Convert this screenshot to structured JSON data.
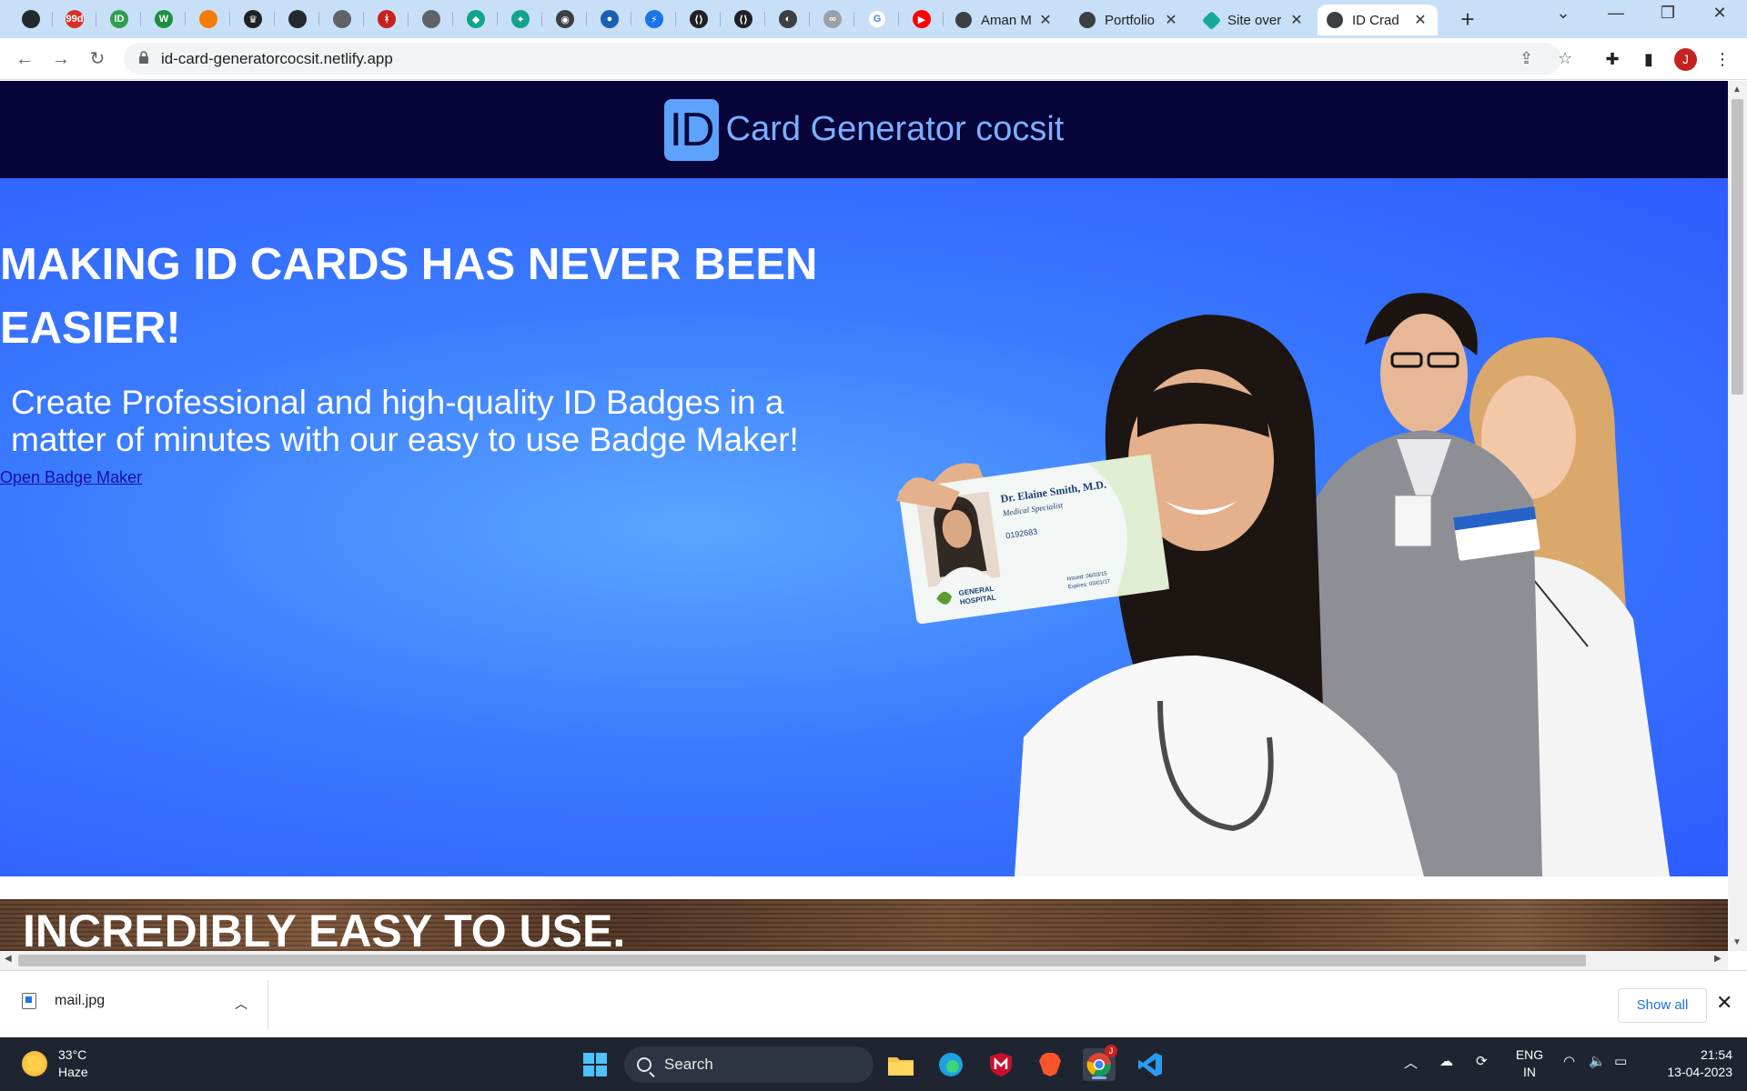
{
  "browser": {
    "pinned_tabs": [
      {
        "icon": "github-icon",
        "color": "#24292e",
        "glyph": ""
      },
      {
        "icon": "99d-icon",
        "color": "#d93025",
        "glyph": "99d"
      },
      {
        "icon": "id-icon",
        "color": "#2e9e4f",
        "glyph": "ID"
      },
      {
        "icon": "w-icon",
        "color": "#1e8e3e",
        "glyph": "W"
      },
      {
        "icon": "orange-chat-icon",
        "color": "#f57c00",
        "glyph": ""
      },
      {
        "icon": "crown-icon",
        "color": "#202124",
        "glyph": "♛"
      },
      {
        "icon": "github-icon",
        "color": "#24292e",
        "glyph": ""
      },
      {
        "icon": "github-icon",
        "color": "#5f6368",
        "glyph": ""
      },
      {
        "icon": "tower-icon",
        "color": "#c5221f",
        "glyph": "ᚼ"
      },
      {
        "icon": "github-icon",
        "color": "#5f6368",
        "glyph": ""
      },
      {
        "icon": "diamond-icon",
        "color": "#12a38a",
        "glyph": "◆"
      },
      {
        "icon": "sparkle-icon",
        "color": "#12a38a",
        "glyph": "✦"
      },
      {
        "icon": "shield-face-icon",
        "color": "#3c4043",
        "glyph": "◉"
      },
      {
        "icon": "person-icon",
        "color": "#1a5fb4",
        "glyph": "●"
      },
      {
        "icon": "bolt-icon",
        "color": "#1a73e8",
        "glyph": "⚡"
      },
      {
        "icon": "code-icon",
        "color": "#202124",
        "glyph": "⟨⟩"
      },
      {
        "icon": "code-icon",
        "color": "#202124",
        "glyph": "⟨⟩"
      },
      {
        "icon": "globe-icon",
        "color": "#3c4043",
        "glyph": "◐"
      },
      {
        "icon": "link-icon",
        "color": "#9aa0a6",
        "glyph": "∞"
      },
      {
        "icon": "google-icon",
        "color": "#ffffff",
        "glyph": "G"
      },
      {
        "icon": "youtube-icon",
        "color": "#ff0000",
        "glyph": "▶"
      }
    ],
    "tabs": [
      {
        "title": "Aman M",
        "icon": "globe-icon",
        "active": false
      },
      {
        "title": "Portfolio",
        "icon": "globe-icon",
        "active": false
      },
      {
        "title": "Site over",
        "icon": "netlify-icon",
        "active": false
      },
      {
        "title": "ID Crad",
        "icon": "globe-icon",
        "active": true
      }
    ],
    "url": "id-card-generatorcocsit.netlify.app",
    "profile_initial": "J"
  },
  "site": {
    "logo_text": "ID",
    "title": "Card Generator cocsit",
    "hero_heading": "MAKING ID CARDS HAS NEVER BEEN EASIER!",
    "hero_sub": "Create Professional and high-quality ID Badges in a matter of minutes with our easy to use Badge Maker!",
    "hero_link": "Open Badge Maker",
    "card": {
      "name": "Dr. Elaine Smith, M.D.",
      "role": "Medical Specialist",
      "number": "0192683",
      "org_line1": "GENERAL",
      "org_line2": "HOSPITAL",
      "issued": "Issued: 06/03/15",
      "expires": "Expires: 03/01/17"
    },
    "band_heading": "INCREDIBLY EASY TO USE."
  },
  "downloads": {
    "file": "mail.jpg",
    "show_all": "Show all"
  },
  "taskbar": {
    "temp": "33°C",
    "weather": "Haze",
    "search_placeholder": "Search",
    "lang1": "ENG",
    "lang2": "IN",
    "time": "21:54",
    "date": "13-04-2023",
    "chrome_badge": "J"
  },
  "colors": {
    "header_bg": "#07043a",
    "title_color": "#7ab0ff",
    "hero_blue": "#3a7bff",
    "link_color": "#1a0dab"
  }
}
